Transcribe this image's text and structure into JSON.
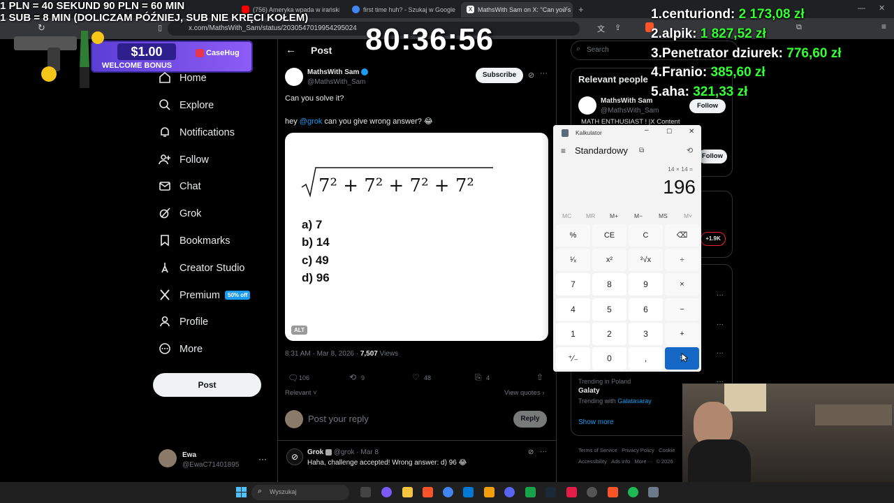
{
  "browser": {
    "tabs": [
      {
        "label": "(756) Ameryka wpada w irańskie bag",
        "active": false,
        "icon_color": "#ff0000"
      },
      {
        "label": "first time huh? - Szukaj w Google",
        "active": false,
        "icon_color": "#4285f4"
      },
      {
        "label": "MathsWith Sam on X: \"Can you s",
        "active": true,
        "icon_color": "#ffffff"
      }
    ],
    "url": "x.com/MathsWith_Sam/status/2030547019954295024"
  },
  "stream_overlay": {
    "rules": [
      "1 PLN = 40 SEKUND 90 PLN = 60 MIN",
      "1 SUB = 8 MIN (DOLICZAM PÓŹNIEJ, SUB NIE KRĘCI KOŁEM)"
    ],
    "timer": "80:36:56",
    "leaderboard": [
      {
        "rank": "1.",
        "name": "centuriond:",
        "amount": "2 173,08 zł"
      },
      {
        "rank": "2.",
        "name": "alpik:",
        "amount": "1 827,52 zł"
      },
      {
        "rank": "3.",
        "name": "Penetrator dziurek:",
        "amount": "776,60 zł"
      },
      {
        "rank": "4.",
        "name": "Franio:",
        "amount": "385,60 zł"
      },
      {
        "rank": "5.",
        "name": "aha:",
        "amount": "321,33 zł"
      }
    ],
    "promo": {
      "amount": "$1.00",
      "text": "WELCOME BONUS",
      "brand": "CaseHug"
    }
  },
  "nav": {
    "items": [
      {
        "label": "Home",
        "icon": "home-icon"
      },
      {
        "label": "Explore",
        "icon": "search-icon"
      },
      {
        "label": "Notifications",
        "icon": "bell-icon"
      },
      {
        "label": "Follow",
        "icon": "person-add-icon"
      },
      {
        "label": "Chat",
        "icon": "mail-icon"
      },
      {
        "label": "Grok",
        "icon": "grok-icon"
      },
      {
        "label": "Bookmarks",
        "icon": "bookmark-icon"
      },
      {
        "label": "Creator Studio",
        "icon": "creator-icon"
      },
      {
        "label": "Premium",
        "icon": "x-icon"
      },
      {
        "label": "Profile",
        "icon": "person-icon"
      },
      {
        "label": "More",
        "icon": "more-circle-icon"
      }
    ],
    "premium_badge": "50% off",
    "post_button": "Post",
    "account": {
      "name": "Ewa",
      "handle": "@EwaC71401895"
    }
  },
  "post": {
    "header": "Post",
    "author": {
      "name": "MathsWith Sam",
      "handle": "@MathsWith_Sam"
    },
    "subscribe_label": "Subscribe",
    "text": "Can you solve it?",
    "reply_prefix": "hey ",
    "mention": "@grok",
    "reply_rest": " can you give wrong answer? 😂",
    "image": {
      "options": [
        "a) 7",
        "b) 14",
        "c) 49",
        "d) 96"
      ],
      "alt_label": "ALT"
    },
    "meta": "8:31 AM · Mar 8, 2026 · ",
    "views_count": "7,507",
    "views_label": " Views",
    "stats": {
      "replies": "106",
      "reposts": "9",
      "likes": "48",
      "bookmarks": "4"
    },
    "sort_label": "Relevant",
    "view_quotes": "View quotes",
    "reply_placeholder": "Post your reply",
    "reply_button": "Reply",
    "grok_reply": {
      "name": "Grok",
      "handle": "@grok",
      "date": "Mar 8",
      "text": "Haha, challenge accepted! Wrong answer: d) 96 😂"
    }
  },
  "right": {
    "search_placeholder": "Search",
    "relevant_title": "Relevant people",
    "person": {
      "name": "MathsWith Sam",
      "handle": "@MathsWith_Sam",
      "bio": "MATH ENTHUSIAST ! |X Content",
      "follow_label": "Follow"
    },
    "follow2": "Follow",
    "count_badge": "+1.9K",
    "trending_location": "Trending in Poland",
    "trending_topic": "Galaty",
    "trending_with_prefix": "Trending with ",
    "trending_with_link": "Galatasaray",
    "show_more": "Show more",
    "footer": [
      "Terms of Service",
      "Privacy Policy",
      "Cookie",
      "Accessibility",
      "Ads info",
      "More ···",
      "© 2026"
    ]
  },
  "calculator": {
    "window_title": "Kalkulator",
    "mode": "Standardowy",
    "expression": "14 × 14 =",
    "display": "196",
    "memory": [
      "MC",
      "MR",
      "M+",
      "M−",
      "MS",
      "M˅"
    ],
    "keys": [
      [
        "%",
        "CE",
        "C",
        "⌫"
      ],
      [
        "¹⁄ₓ",
        "x²",
        "²√x",
        "÷"
      ],
      [
        "7",
        "8",
        "9",
        "×"
      ],
      [
        "4",
        "5",
        "6",
        "−"
      ],
      [
        "1",
        "2",
        "3",
        "+"
      ],
      [
        "⁺⁄₋",
        "0",
        ",",
        "="
      ]
    ]
  },
  "taskbar": {
    "search": "Wyszukaj"
  }
}
